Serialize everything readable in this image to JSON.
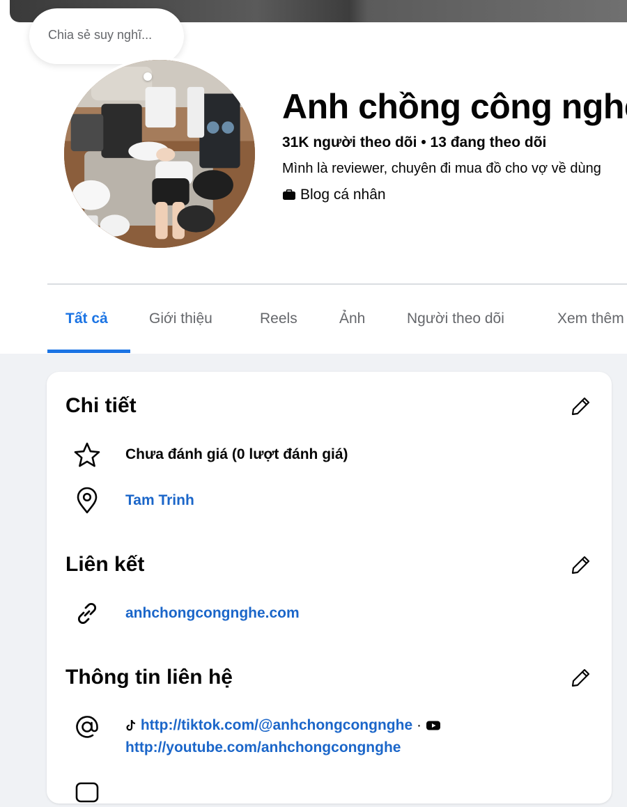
{
  "composer": {
    "placeholder": "Chia sẻ suy nghĩ..."
  },
  "profile": {
    "name": "Anh chồng công nghệ",
    "followers": "31K người theo dõi",
    "separator": "•",
    "following": "13 đang theo dõi",
    "bio": "Mình là reviewer, chuyên đi mua đồ cho vợ về dùng",
    "category": "Blog cá nhân"
  },
  "tabs": [
    {
      "label": "Tất cả",
      "active": true
    },
    {
      "label": "Giới thiệu"
    },
    {
      "label": "Reels"
    },
    {
      "label": "Ảnh"
    },
    {
      "label": "Người theo dõi"
    },
    {
      "label": "Xem thêm"
    }
  ],
  "details": {
    "title": "Chi tiết",
    "rating": "Chưa đánh giá (0 lượt đánh giá)",
    "location": "Tam Trinh"
  },
  "links": {
    "title": "Liên kết",
    "website": "anhchongcongnghe.com"
  },
  "contact": {
    "title": "Thông tin liên hệ",
    "tiktok": "http://tiktok.com/@anhchongcongnghe",
    "separator": "·",
    "youtube": "http://youtube.com/anhchongcongnghe"
  },
  "colors": {
    "accent": "#1b74e4",
    "link": "#1b66c9",
    "muted": "#65676b"
  }
}
